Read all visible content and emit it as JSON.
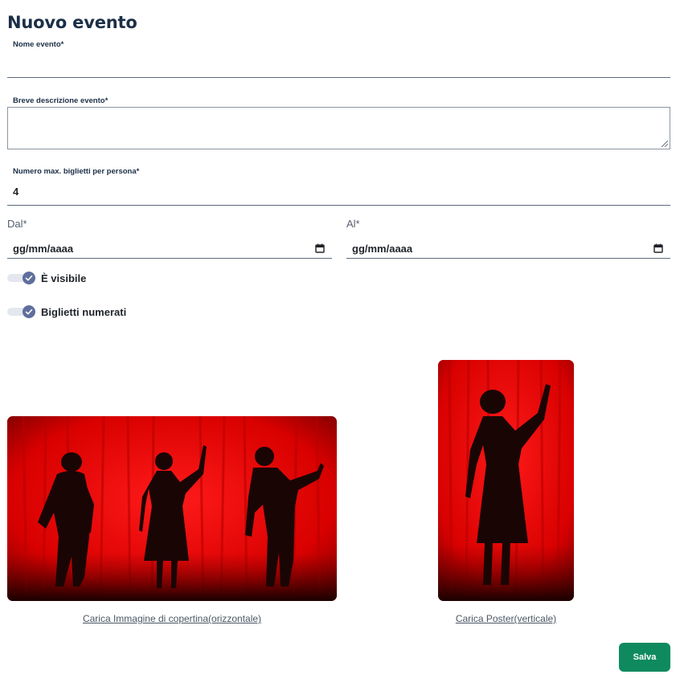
{
  "form": {
    "title": "Nuovo evento",
    "name": {
      "label": "Nome evento*",
      "value": ""
    },
    "description": {
      "label": "Breve descrizione evento*",
      "value": ""
    },
    "max_tickets": {
      "label": "Numero max. biglietti per persona*",
      "value": "4"
    },
    "from": {
      "label": "Dal*",
      "placeholder": "gg/mm/aaaa"
    },
    "to": {
      "label": "Al*",
      "placeholder": "gg/mm/aaaa"
    },
    "toggles": [
      {
        "label": "È visibile",
        "checked": true
      },
      {
        "label": "Biglietti numerati",
        "checked": true
      }
    ],
    "cover_image": {
      "link_text": "Carica Immagine di copertina(orizzontale)"
    },
    "poster_image": {
      "link_text": "Carica Poster(verticale)"
    },
    "save_label": "Salva"
  },
  "colors": {
    "title": "#1c2f47",
    "toggle_knob": "#5f6e9d",
    "save_button": "#0f8a5f",
    "curtain_red": "#e00000"
  },
  "icons": {
    "calendar": "calendar-icon",
    "check": "check-icon"
  }
}
